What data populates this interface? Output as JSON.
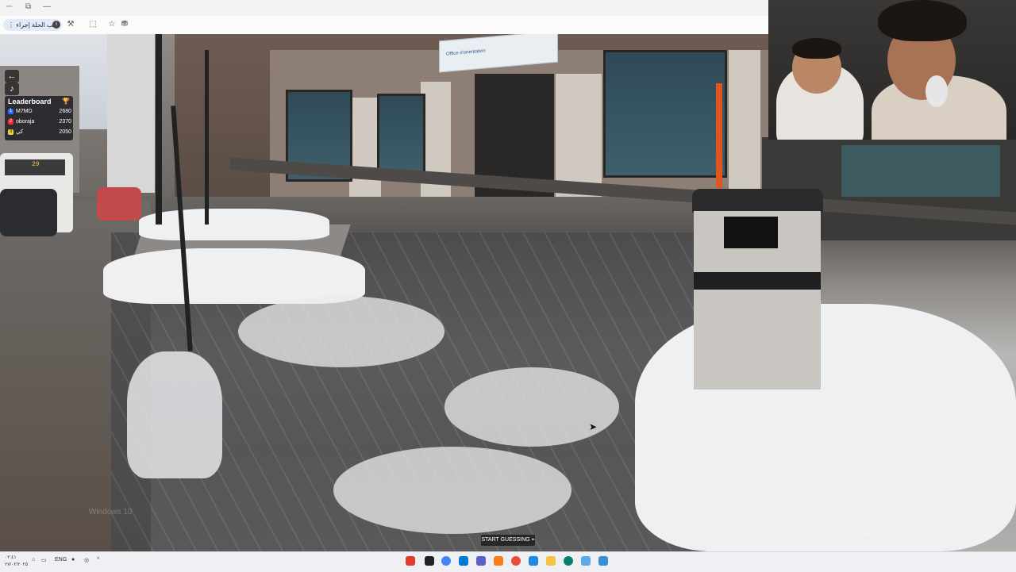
{
  "browser": {
    "address_chip": "⋮ يتب الحلة إجراء",
    "icons": [
      "info-icon",
      "tools-icon",
      "extension-icon",
      "bookmark-icon",
      "cast-icon"
    ]
  },
  "game": {
    "leaderboard": {
      "title": "Leaderboard",
      "rows": [
        {
          "rank": "1",
          "name": "M7MD",
          "score": "2680",
          "color": "#2c6bff"
        },
        {
          "rank": "2",
          "name": "oboraja",
          "score": "2370",
          "color": "#ff2a2a"
        },
        {
          "rank": "3",
          "name": "كي",
          "score": "2050",
          "color": "#f3d23b"
        }
      ]
    },
    "start_button": "START GUESSING",
    "watermark": "Windows 10",
    "image_id": "Mkhfw2F2p1Q02yf1bSGtdSJfwHK9m1b"
  },
  "scene": {
    "sign_text": "Office d'orientation",
    "bus_display": "29"
  },
  "taskbar": {
    "clock": "٠٢:٤١",
    "date": "٢٧/٠٢/٢٠٢٥",
    "language": "ENG",
    "app_colors": [
      "#e33a2a",
      "#222222",
      "#4285f4",
      "#0078d4",
      "#5b5fc7",
      "#ff7a1a",
      "#e94b3c",
      "#1e88e5",
      "#0a7e6f",
      "#5caae9",
      "#3a8fd9"
    ]
  }
}
